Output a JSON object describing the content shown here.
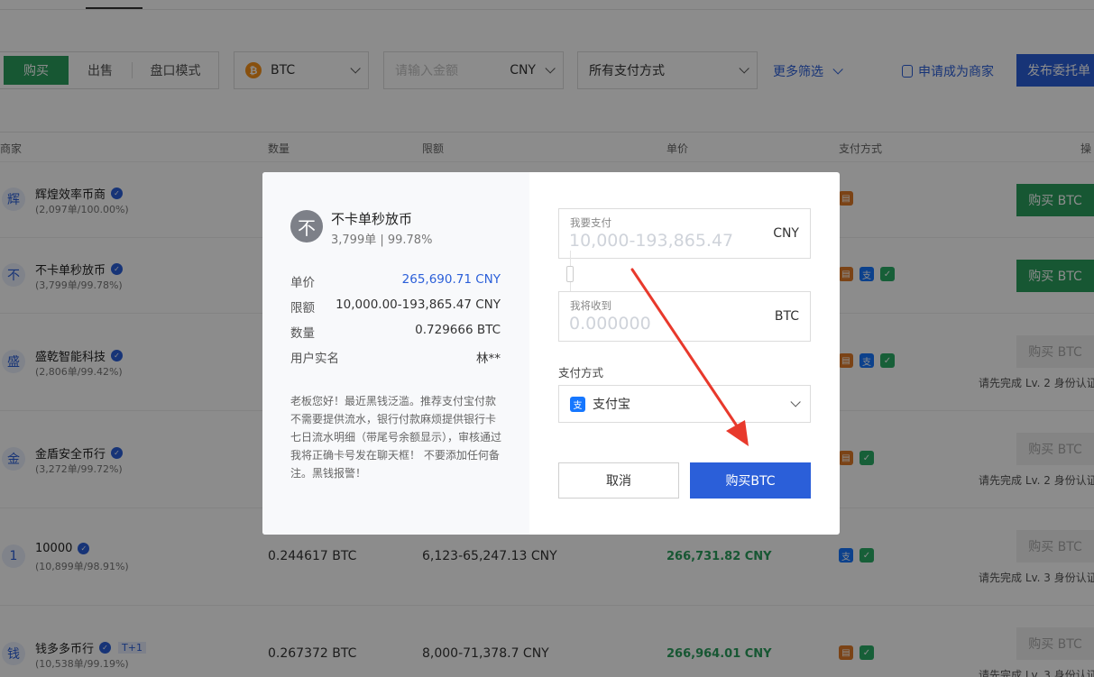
{
  "toolbar": {
    "buy": "购买",
    "sell": "出售",
    "mode": "盘口模式",
    "coin": "BTC",
    "amount_placeholder": "请输入金额",
    "currency": "CNY",
    "payment_filter": "所有支付方式",
    "more_filters": "更多筛选",
    "apply_merchant": "申请成为商家",
    "publish": "发布委托单"
  },
  "table": {
    "headers": {
      "merchant": "商家",
      "qty": "数量",
      "limit": "限额",
      "price": "单价",
      "payment": "支付方式",
      "action": "操"
    },
    "rows": [
      {
        "avatar": "辉",
        "name": "辉煌效率币商",
        "stats": "(2,097单/100.00%)",
        "qty": "",
        "limit": "",
        "price": "",
        "action": "购买 BTC",
        "kyc": ""
      },
      {
        "avatar": "不",
        "name": "不卡单秒放币",
        "stats": "(3,799单/99.78%)",
        "qty": "",
        "limit": "",
        "price": "",
        "action": "购买 BTC",
        "kyc": ""
      },
      {
        "avatar": "盛",
        "name": "盛乾智能科技",
        "stats": "(2,806单/99.42%)",
        "qty": "",
        "limit": "",
        "price": "",
        "action": "购买 BTC",
        "kyc": "请先完成 Lv. 2 身份认证"
      },
      {
        "avatar": "金",
        "name": "金盾安全币行",
        "stats": "(3,272单/99.72%)",
        "qty": "",
        "limit": "",
        "price": "",
        "action": "购买 BTC",
        "kyc": "请先完成 Lv. 2 身份认证"
      },
      {
        "avatar": "1",
        "name": "10000",
        "stats": "(10,899单/98.91%)",
        "qty": "0.244617 BTC",
        "limit": "6,123-65,247.13 CNY",
        "price": "266,731.82 CNY",
        "action": "购买 BTC",
        "kyc": "请先完成 Lv. 3 身份认证"
      },
      {
        "avatar": "钱",
        "name": "钱多多币行",
        "badge": "T+1",
        "stats": "(10,538单/99.19%)",
        "qty": "0.267372 BTC",
        "limit": "8,000-71,378.7 CNY",
        "price": "266,964.01 CNY",
        "action": "购买 BTC",
        "kyc": "请先完成 Lv. 3 身份认证"
      }
    ]
  },
  "modal": {
    "avatar": "不",
    "merchant": "不卡单秒放币",
    "stats": "3,799单 | 99.78%",
    "price_label": "单价",
    "price": "265,690.71 CNY",
    "limit_label": "限额",
    "limit": "10,000.00-193,865.47 CNY",
    "qty_label": "数量",
    "qty": "0.729666 BTC",
    "realname_label": "用户实名",
    "realname": "林**",
    "note": "老板您好！最近黑钱泛滥。推荐支付宝付款不需要提供流水，银行付款麻烦提供银行卡七日流水明细（带尾号余额显示），审核通过我将正确卡号发在聊天框！ 不要添加任何备注。黑钱报警！",
    "pay_label": "我要支付",
    "pay_placeholder": "10,000-193,865.47",
    "pay_unit": "CNY",
    "receive_label": "我将收到",
    "receive_placeholder": "0.000000",
    "receive_unit": "BTC",
    "method_label": "支付方式",
    "method": "支付宝",
    "cancel": "取消",
    "confirm": "购买BTC"
  },
  "colors": {
    "accent": "#2b5fd9",
    "buy_green": "#2b9e5d",
    "arrow": "#e8392c"
  }
}
